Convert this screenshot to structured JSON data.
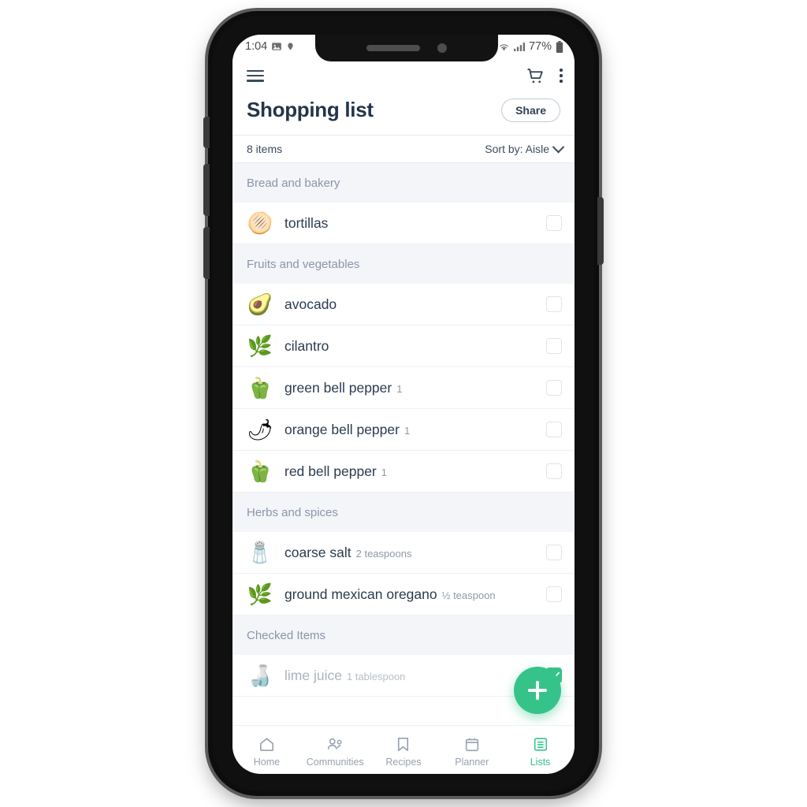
{
  "status_bar": {
    "time": "1:04",
    "left_icons": [
      "image-icon",
      "location-icon"
    ],
    "right_icons": [
      "wifi-icon",
      "signal-icon"
    ],
    "battery": "77%"
  },
  "app_bar": {
    "menu_icon": "hamburger-menu-icon",
    "cart_icon": "shopping-cart-icon",
    "overflow_icon": "more-vertical-icon"
  },
  "header": {
    "title": "Shopping list",
    "share_label": "Share"
  },
  "meta": {
    "item_count": "8 items",
    "sort_label": "Sort by: Aisle"
  },
  "sections": [
    {
      "title": "Bread and bakery",
      "items": [
        {
          "thumb": "🫓",
          "name": "tortillas",
          "qty": "",
          "checked": false
        }
      ]
    },
    {
      "title": "Fruits and vegetables",
      "items": [
        {
          "thumb": "🥑",
          "name": "avocado",
          "qty": "",
          "checked": false
        },
        {
          "thumb": "🌿",
          "name": "cilantro",
          "qty": "",
          "checked": false
        },
        {
          "thumb": "🫑",
          "name": "green bell pepper",
          "qty": "1",
          "checked": false
        },
        {
          "thumb": "🌶",
          "name": "orange bell pepper",
          "qty": "1",
          "checked": false
        },
        {
          "thumb": "🫑",
          "name": "red bell pepper",
          "qty": "1",
          "checked": false
        }
      ]
    },
    {
      "title": "Herbs and spices",
      "items": [
        {
          "thumb": "🧂",
          "name": "coarse salt",
          "qty": "2 teaspoons",
          "checked": false
        },
        {
          "thumb": "🌿",
          "name": "ground mexican oregano",
          "qty": "½ teaspoon",
          "checked": false
        }
      ]
    },
    {
      "title": "Checked Items",
      "items": [
        {
          "thumb": "🍶",
          "name": "lime juice",
          "qty": "1 tablespoon",
          "checked": true
        }
      ]
    }
  ],
  "fab": {
    "label": "add-item"
  },
  "bottom_nav": {
    "items": [
      {
        "icon": "home-icon",
        "label": "Home",
        "active": false
      },
      {
        "icon": "communities-people-icon",
        "label": "Communities",
        "active": false
      },
      {
        "icon": "bookmark-icon",
        "label": "Recipes",
        "active": false
      },
      {
        "icon": "calendar-icon",
        "label": "Planner",
        "active": false
      },
      {
        "icon": "list-icon",
        "label": "Lists",
        "active": true
      }
    ]
  },
  "system_nav": {
    "back": "back-icon",
    "home": "home-square-icon",
    "recents": "recents-icon"
  },
  "colors": {
    "accent_green": "#36c38a",
    "text_dark": "#2a3b4f",
    "text_muted": "#8a95a8",
    "section_bg": "#f3f5f9"
  }
}
